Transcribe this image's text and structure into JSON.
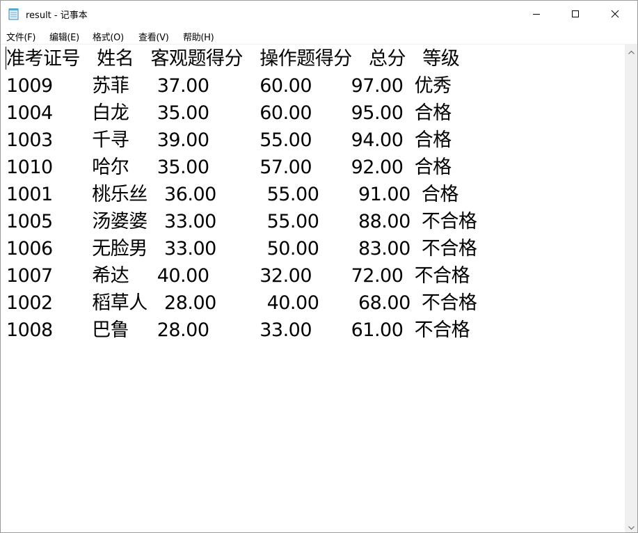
{
  "window": {
    "title": "result - 记事本"
  },
  "menubar": {
    "items": [
      "文件(F)",
      "编辑(E)",
      "格式(O)",
      "查看(V)",
      "帮助(H)"
    ]
  },
  "document": {
    "lines": [
      "准考证号   姓名   客观题得分   操作题得分   总分   等级",
      "1009       苏菲     37.00         60.00       97.00  优秀",
      "1004       白龙     35.00         60.00       95.00  合格",
      "1003       千寻     39.00         55.00       94.00  合格",
      "1010       哈尔     35.00         57.00       92.00  合格",
      "1001       桃乐丝   36.00         55.00       91.00  合格",
      "1005       汤婆婆   33.00         55.00       88.00  不合格",
      "1006       无脸男   33.00         50.00       83.00  不合格",
      "1007       希达     40.00         32.00       72.00  不合格",
      "1002       稻草人   28.00         40.00       68.00  不合格",
      "1008       巴鲁     28.00         33.00       61.00  不合格"
    ]
  },
  "icons": {
    "app": "notepad-icon",
    "minimize": "minimize-icon",
    "maximize": "maximize-icon",
    "close": "close-icon"
  }
}
